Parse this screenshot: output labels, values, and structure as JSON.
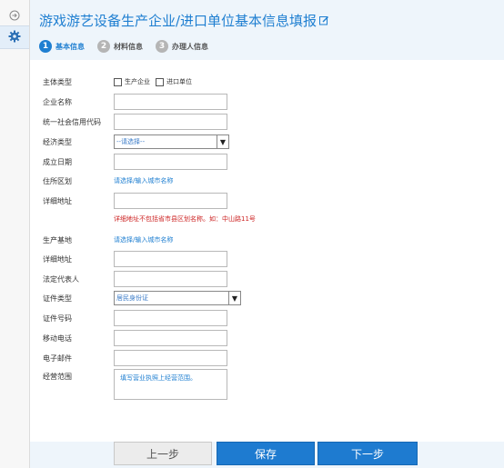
{
  "sidebar": {
    "icons": [
      "exit-icon",
      "gear-icon"
    ]
  },
  "header": {
    "title": "游戏游艺设备生产企业/进口单位基本信息填报"
  },
  "steps": [
    {
      "num": "1",
      "label": "基本信息",
      "active": true
    },
    {
      "num": "2",
      "label": "材料信息",
      "active": false
    },
    {
      "num": "3",
      "label": "办理人信息",
      "active": false
    }
  ],
  "form": {
    "subject_type": {
      "label": "主体类型",
      "options": [
        "生产企业",
        "进口单位"
      ]
    },
    "company_name": {
      "label": "企业名称",
      "value": ""
    },
    "credit_code": {
      "label": "统一社会信用代码",
      "value": ""
    },
    "economic_type": {
      "label": "经济类型",
      "selected": "--请选择--"
    },
    "establish_date": {
      "label": "成立日期",
      "value": ""
    },
    "residence_region": {
      "label": "住所区划",
      "link": "请选择/输入城市名称"
    },
    "detail_address": {
      "label": "详细地址",
      "value": ""
    },
    "address_hint": "详细地址不包括省市县区划名称。如：中山路11号",
    "production_base": {
      "label": "生产基地",
      "link": "请选择/输入城市名称"
    },
    "base_detail_address": {
      "label": "详细地址",
      "value": ""
    },
    "legal_rep": {
      "label": "法定代表人",
      "value": ""
    },
    "id_type": {
      "label": "证件类型",
      "selected": "居民身份证"
    },
    "id_number": {
      "label": "证件号码",
      "value": ""
    },
    "mobile": {
      "label": "移动电话",
      "value": ""
    },
    "email": {
      "label": "电子邮件",
      "value": ""
    },
    "business_scope": {
      "label": "经营范围",
      "placeholder": "填写营业执照上经营范围。"
    }
  },
  "buttons": {
    "prev": "上一步",
    "save": "保存",
    "next": "下一步"
  }
}
